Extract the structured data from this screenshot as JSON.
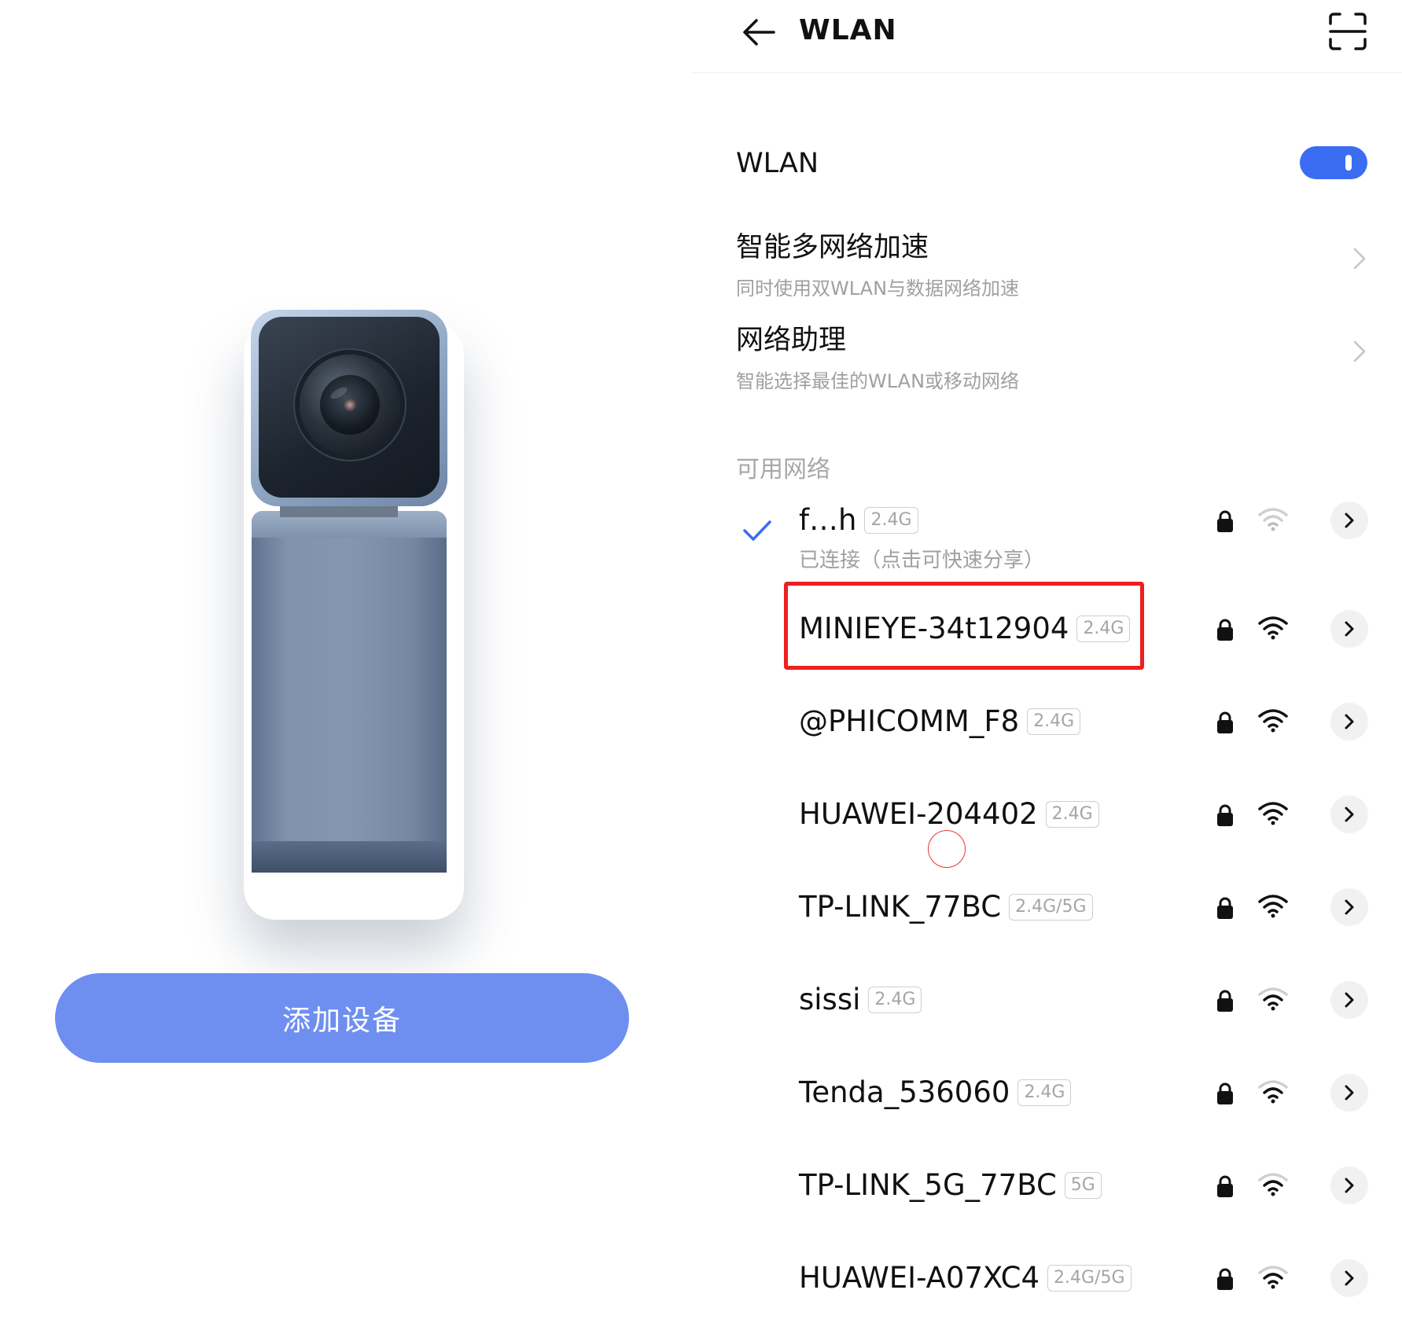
{
  "left": {
    "add_device_label": "添加设备",
    "accent_color": "#6e8ff0"
  },
  "wlan": {
    "header_title": "WLAN",
    "toggle_label": "WLAN",
    "toggle_on": true,
    "settings": [
      {
        "title": "智能多网络加速",
        "subtitle": "同时使用双WLAN与数据网络加速"
      },
      {
        "title": "网络助理",
        "subtitle": "智能选择最佳的WLAN或移动网络"
      }
    ],
    "section_title": "可用网络",
    "networks": [
      {
        "name": "f…h",
        "band": "2.4G",
        "status": "已连接（点击可快速分享）",
        "connected": true,
        "locked": true,
        "signal": "weak"
      },
      {
        "name": "MINIEYE-34t12904",
        "band": "2.4G",
        "locked": true,
        "signal": "strong",
        "highlighted": true
      },
      {
        "name": "@PHICOMM_F8",
        "band": "2.4G",
        "locked": true,
        "signal": "strong"
      },
      {
        "name": "HUAWEI-204402",
        "band": "2.4G",
        "locked": true,
        "signal": "strong"
      },
      {
        "name": "TP-LINK_77BC",
        "band": "2.4G/5G",
        "locked": true,
        "signal": "strong"
      },
      {
        "name": "sissi",
        "band": "2.4G",
        "locked": true,
        "signal": "medium"
      },
      {
        "name": "Tenda_536060",
        "band": "2.4G",
        "locked": true,
        "signal": "medium"
      },
      {
        "name": "TP-LINK_5G_77BC",
        "band": "5G",
        "locked": true,
        "signal": "medium"
      },
      {
        "name": "HUAWEI-A07XC4",
        "band": "2.4G/5G",
        "locked": true,
        "signal": "medium"
      }
    ],
    "accent_color": "#3b6df2",
    "highlight_color": "#ee1f1f"
  }
}
